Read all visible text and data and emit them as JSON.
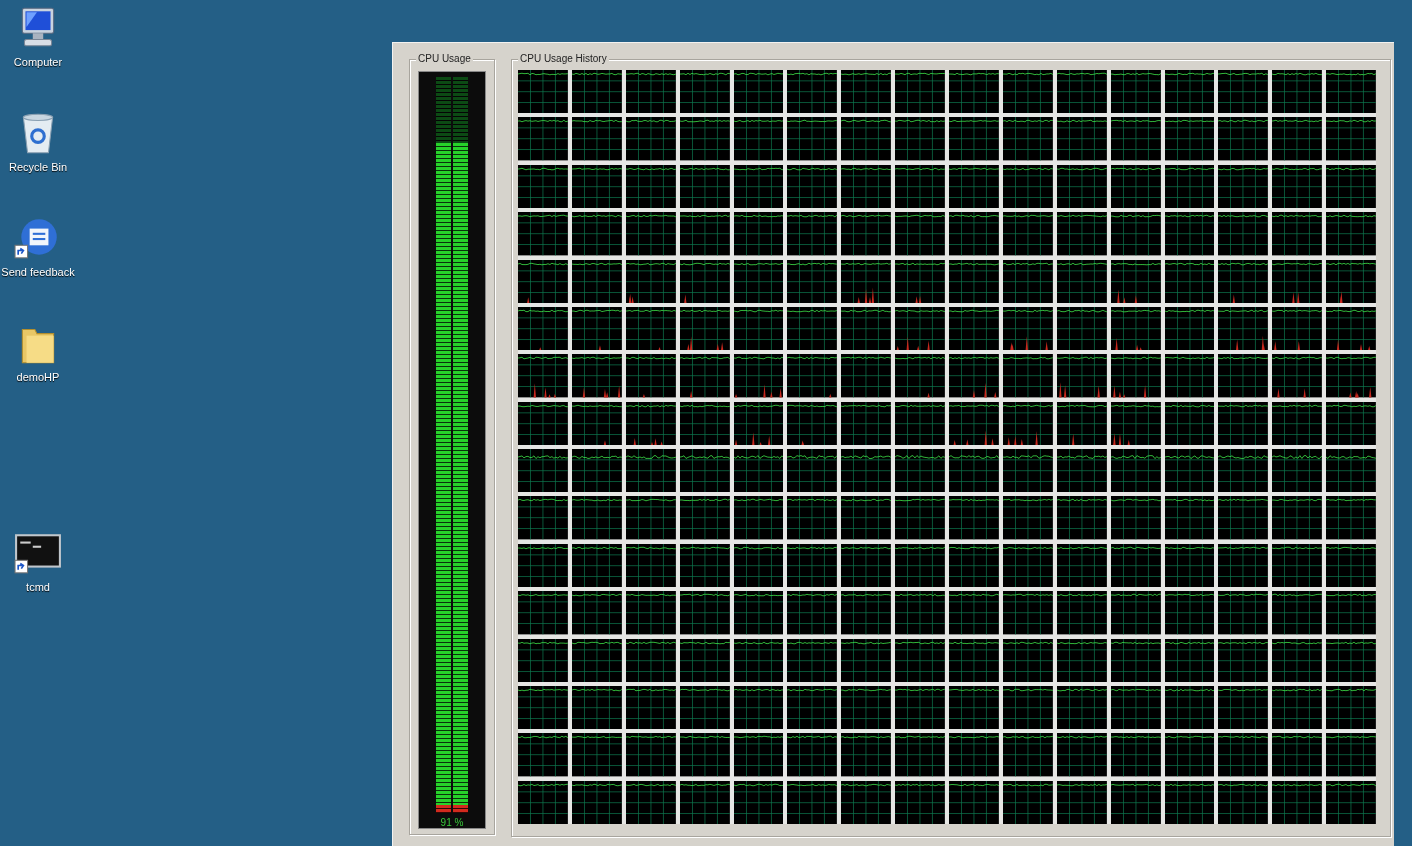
{
  "desktop_icons": [
    {
      "label": "Computer",
      "kind": "computer",
      "shortcut": false
    },
    {
      "label": "Recycle Bin",
      "kind": "recycle-bin",
      "shortcut": false
    },
    {
      "label": "Send feedback",
      "kind": "feedback",
      "shortcut": true
    },
    {
      "label": "demoHP",
      "kind": "folder",
      "shortcut": false
    },
    {
      "label": "tcmd",
      "kind": "console",
      "shortcut": true
    }
  ],
  "cpu_usage": {
    "title": "CPU Usage",
    "level": 0.91,
    "reading": "91 %"
  },
  "cpu_usage_history": {
    "title": "CPU Usage History"
  }
}
